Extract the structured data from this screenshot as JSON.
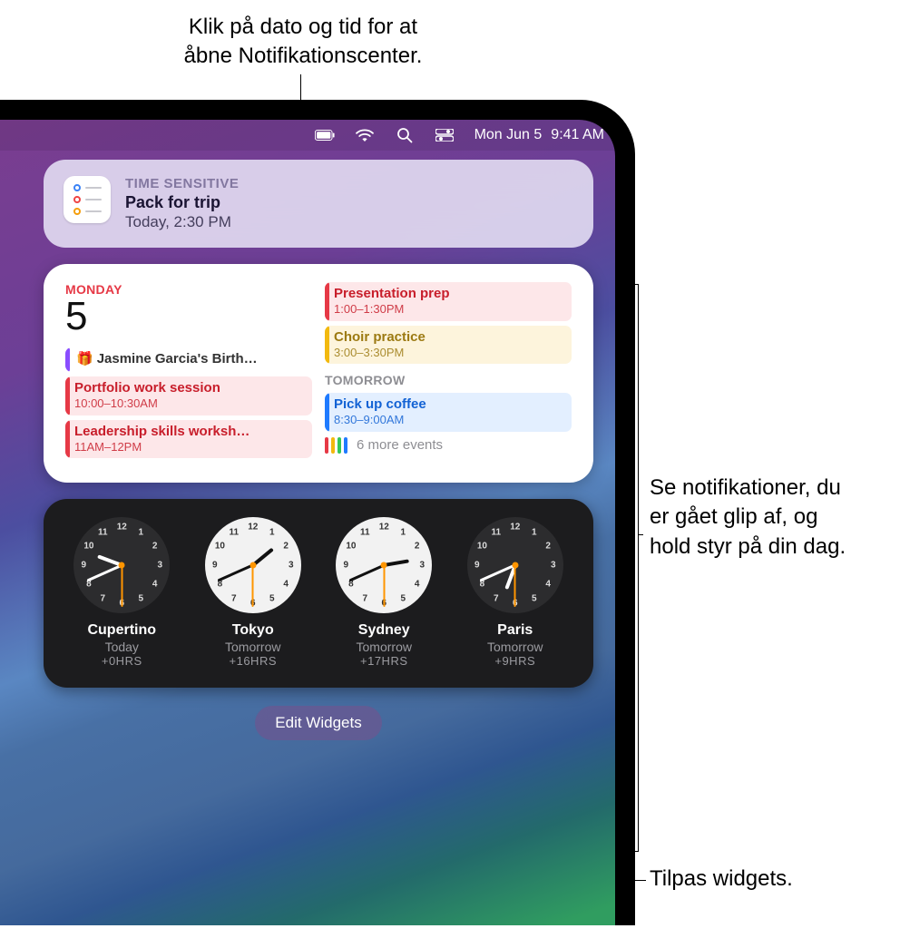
{
  "callouts": {
    "top": "Klik på dato og tid for at\nåbne Notifikationscenter.",
    "right": "Se notifikationer, du\ner gået glip af, og\nhold styr på din dag.",
    "edit": "Tilpas widgets."
  },
  "menubar": {
    "date": "Mon Jun 5",
    "time": "9:41 AM"
  },
  "notification": {
    "label": "TIME SENSITIVE",
    "title": "Pack for trip",
    "subtitle": "Today, 2:30 PM"
  },
  "calendar": {
    "day_label": "MONDAY",
    "day_number": "5",
    "tomorrow_label": "TOMORROW",
    "left_events": [
      {
        "kind": "allday",
        "title": "Jasmine Garcia's Birth…"
      },
      {
        "kind": "red",
        "title": "Portfolio work session",
        "time": "10:00–10:30AM"
      },
      {
        "kind": "red",
        "title": "Leadership skills worksh…",
        "time": "11AM–12PM"
      }
    ],
    "right_events": [
      {
        "kind": "red",
        "title": "Presentation prep",
        "time": "1:00–1:30PM"
      },
      {
        "kind": "yellow",
        "title": "Choir practice",
        "time": "3:00–3:30PM"
      }
    ],
    "tomorrow_events": [
      {
        "kind": "blue",
        "title": "Pick up coffee",
        "time": "8:30–9:00AM"
      }
    ],
    "more": "6 more events"
  },
  "clocks": [
    {
      "city": "Cupertino",
      "day": "Today",
      "offset": "+0HRS",
      "face": "dark",
      "h": 9,
      "m": 41,
      "s": 30
    },
    {
      "city": "Tokyo",
      "day": "Tomorrow",
      "offset": "+16HRS",
      "face": "light",
      "h": 1,
      "m": 41,
      "s": 30
    },
    {
      "city": "Sydney",
      "day": "Tomorrow",
      "offset": "+17HRS",
      "face": "light",
      "h": 2,
      "m": 41,
      "s": 30
    },
    {
      "city": "Paris",
      "day": "Tomorrow",
      "offset": "+9HRS",
      "face": "dark",
      "h": 6,
      "m": 41,
      "s": 30
    }
  ],
  "edit_widgets": "Edit Widgets"
}
